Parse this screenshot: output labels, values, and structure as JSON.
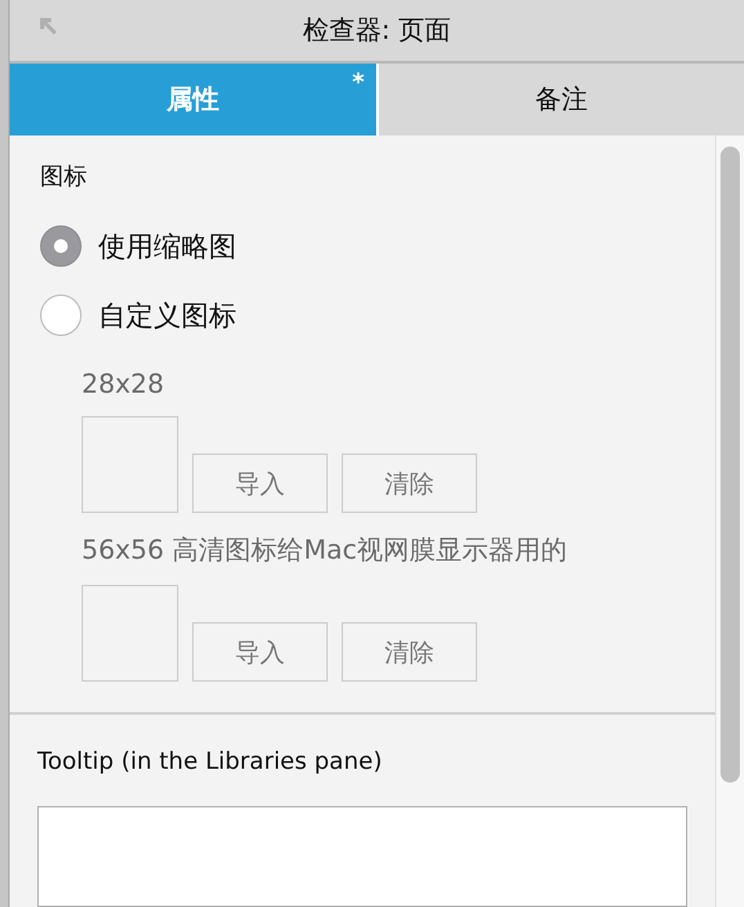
{
  "window": {
    "title": "检查器: 页面"
  },
  "tabs": [
    {
      "label": "属性",
      "selected": true,
      "badge": "*"
    },
    {
      "label": "备注",
      "selected": false
    }
  ],
  "icon_section": {
    "heading": "图标",
    "options": [
      {
        "label": "使用缩略图",
        "selected": true
      },
      {
        "label": "自定义图标",
        "selected": false
      }
    ],
    "slots": [
      {
        "label": "28x28",
        "buttons": [
          "导入",
          "清除"
        ]
      },
      {
        "label": "56x56 高清图标给Mac视网膜显示器用的",
        "buttons": [
          "导入",
          "清除"
        ]
      }
    ]
  },
  "tooltip": {
    "label": "Tooltip (in the Libraries pane)"
  }
}
